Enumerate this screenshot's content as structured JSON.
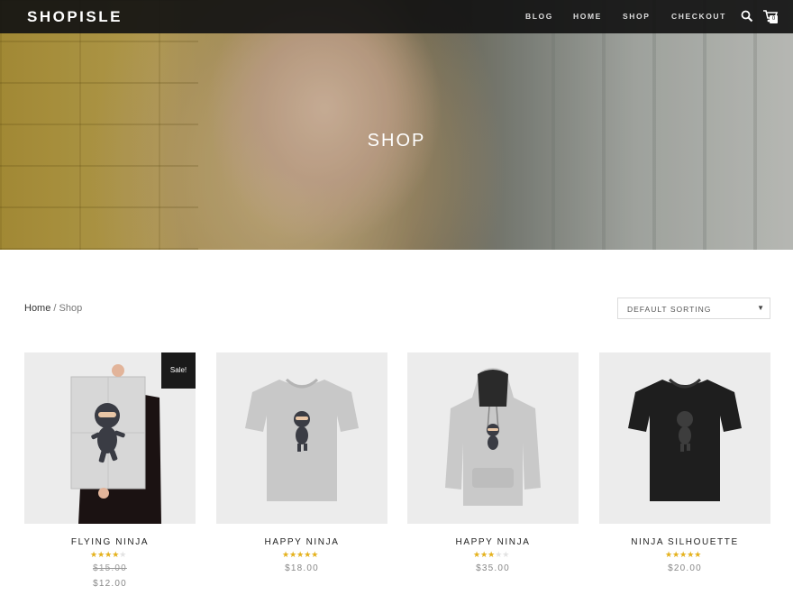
{
  "header": {
    "logo": "SHOPISLE",
    "nav": [
      "BLOG",
      "HOME",
      "SHOP",
      "CHECKOUT"
    ],
    "cart_count": "0",
    "icons": [
      "search-icon",
      "cart-icon"
    ]
  },
  "hero": {
    "title": "SHOP"
  },
  "breadcrumb": {
    "home": "Home",
    "separator": " / ",
    "current": "Shop"
  },
  "sorting": {
    "selected": "DEFAULT SORTING"
  },
  "colors": {
    "accent_star": "#e6b21b",
    "topbar": "#121212",
    "badge": "#1a1a1a"
  },
  "products": [
    {
      "name": "FLYING NINJA",
      "rating": 4,
      "old_price": "$15.00",
      "price": "$12.00",
      "badge": "Sale!"
    },
    {
      "name": "HAPPY NINJA",
      "rating": 5,
      "price": "$18.00"
    },
    {
      "name": "HAPPY NINJA",
      "rating": 3,
      "price": "$35.00"
    },
    {
      "name": "NINJA SILHOUETTE",
      "rating": 5,
      "price": "$20.00"
    }
  ]
}
